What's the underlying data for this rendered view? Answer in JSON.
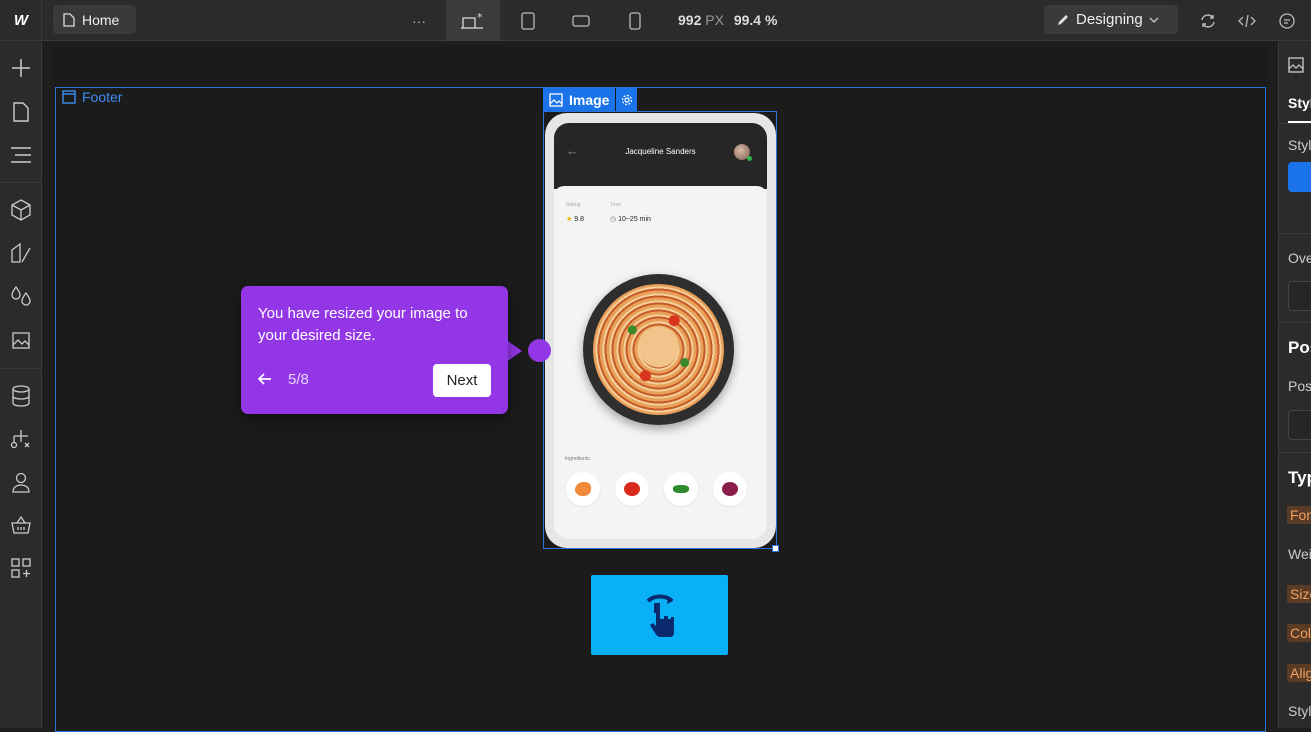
{
  "topbar": {
    "logo": "W",
    "page_label": "Home",
    "more": "···",
    "width_value": "992",
    "width_unit": "PX",
    "zoom": "99.4 %",
    "mode_label": "Designing"
  },
  "canvas": {
    "footer_label": "Footer",
    "image_label": "Image"
  },
  "phone": {
    "title": "Jacqueline Sanders",
    "rating_label": "Rating",
    "rating_value": "9.8",
    "time_label": "Time",
    "time_value": "10~25 min",
    "ingredients_label": "Ingredients"
  },
  "tooltip": {
    "text": "You have resized your image to your desired size.",
    "step": "5/8",
    "next_label": "Next"
  },
  "right_panel": {
    "tab_style": "Styl",
    "style_sel": "Styl",
    "overrides": "Ove",
    "position_h": "Pos",
    "position": "Pos",
    "typography_h": "Typ",
    "font": "Fon",
    "weight": "Wei",
    "size": "Size",
    "color": "Colo",
    "align": "Alig",
    "style": "Styl"
  },
  "colors": {
    "accent": "#1a73e8",
    "tooltip": "#9336e6",
    "tap_button": "#0ab0f5"
  }
}
